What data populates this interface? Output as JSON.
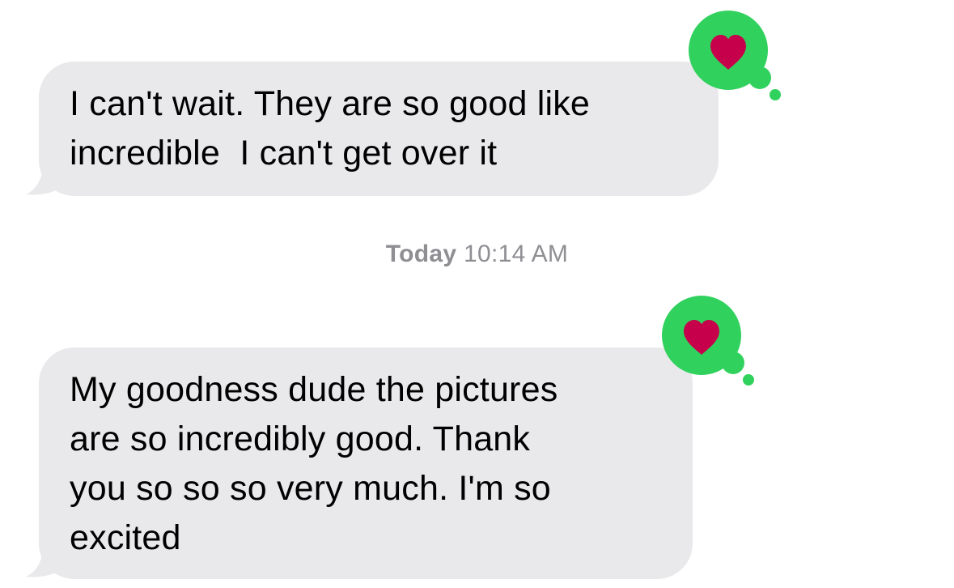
{
  "messages": [
    {
      "text": "I can't wait. They are so good like\nincredible  I can't get over it",
      "reaction": "heart-icon",
      "reaction_color": "#c6004a",
      "reaction_bubble_color": "#31d15e"
    },
    {
      "text": "My goodness dude the pictures\nare so incredibly good. Thank\nyou so so so very much. I'm so\nexcited",
      "reaction": "heart-icon",
      "reaction_color": "#c6004a",
      "reaction_bubble_color": "#31d15e"
    }
  ],
  "timestamp": {
    "day": "Today",
    "time": "10:14 AM"
  },
  "colors": {
    "incoming_bubble": "#e9e9eb",
    "timestamp_text": "#8e8e93"
  }
}
